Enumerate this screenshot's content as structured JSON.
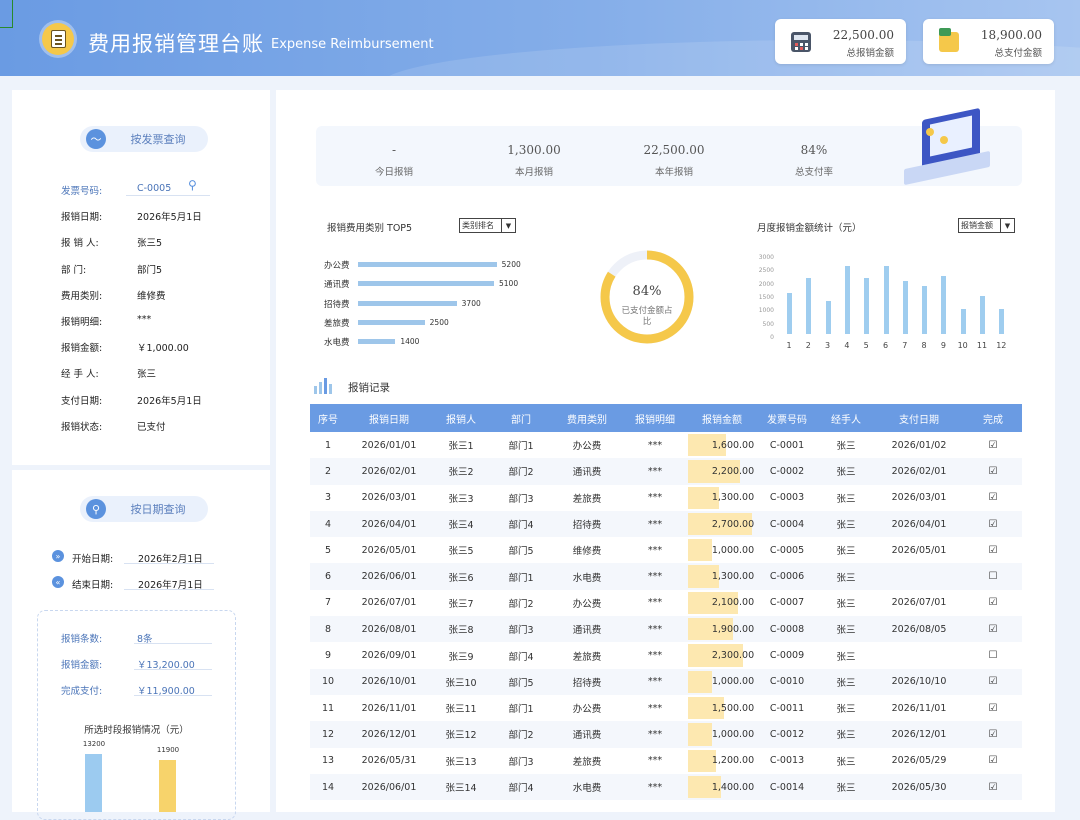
{
  "header": {
    "title": "费用报销管理台账",
    "subtitle": "Expense Reimbursement",
    "cards": [
      {
        "value": "22,500.00",
        "label": "总报销金额",
        "icon": "calculator-icon"
      },
      {
        "value": "18,900.00",
        "label": "总支付金额",
        "icon": "wallet-icon"
      }
    ]
  },
  "invoice_query": {
    "button": "按发票查询",
    "fields": [
      {
        "label": "发票号码:",
        "value": "C-0005"
      },
      {
        "label": "报销日期:",
        "value": "2026年5月1日"
      },
      {
        "label": "报 销 人:",
        "value": "张三5"
      },
      {
        "label": "部     门:",
        "value": "部门5"
      },
      {
        "label": "费用类别:",
        "value": "维修费"
      },
      {
        "label": "报销明细:",
        "value": "***"
      },
      {
        "label": "报销金额:",
        "value": "￥1,000.00"
      },
      {
        "label": "经 手 人:",
        "value": "张三"
      },
      {
        "label": "支付日期:",
        "value": "2026年5月1日"
      },
      {
        "label": "报销状态:",
        "value": "已支付"
      }
    ]
  },
  "date_query": {
    "button": "按日期查询",
    "start": {
      "label": "开始日期:",
      "value": "2026年2月1日"
    },
    "end": {
      "label": "结束日期:",
      "value": "2026年7月1日"
    },
    "summary": [
      {
        "label": "报销条数:",
        "value": "8条"
      },
      {
        "label": "报销金额:",
        "value": "￥13,200.00"
      },
      {
        "label": "完成支付:",
        "value": "￥11,900.00"
      }
    ],
    "chart": {
      "title": "所选时段报销情况（元）",
      "values": [
        {
          "value": 13200,
          "label": "13200",
          "color": "#9ccbf0"
        },
        {
          "value": 11900,
          "label": "11900",
          "color": "#f7d36b"
        }
      ]
    }
  },
  "stats": [
    {
      "value": "-",
      "label": "今日报销"
    },
    {
      "value": "1,300.00",
      "label": "本月报销"
    },
    {
      "value": "22,500.00",
      "label": "本年报销"
    },
    {
      "value": "84%",
      "label": "总支付率"
    }
  ],
  "top5": {
    "title": "报销费用类别 TOP5",
    "select": "类别排名",
    "chart_data": {
      "type": "bar",
      "categories": [
        "办公费",
        "通讯费",
        "招待费",
        "差旅费",
        "水电费"
      ],
      "values": [
        5200,
        5100,
        3700,
        2500,
        1400
      ],
      "xlim": [
        0,
        6000
      ]
    }
  },
  "donut": {
    "value": "84%",
    "label": "已支付金额占比",
    "fraction": 0.84
  },
  "monthly": {
    "title": "月度报销金额统计（元）",
    "select": "报销金额",
    "chart_data": {
      "type": "bar",
      "categories": [
        "1",
        "2",
        "3",
        "4",
        "5",
        "6",
        "7",
        "8",
        "9",
        "10",
        "11",
        "12"
      ],
      "values": [
        1600,
        2200,
        1300,
        2700,
        2200,
        2700,
        2100,
        1900,
        2300,
        1000,
        1500,
        1000
      ],
      "yticks": [
        "3000",
        "2500",
        "2000",
        "1500",
        "1000",
        "500",
        "0"
      ],
      "ylim": [
        0,
        3000
      ]
    }
  },
  "records": {
    "title": "报销记录",
    "columns": [
      "序号",
      "报销日期",
      "报销人",
      "部门",
      "费用类别",
      "报销明细",
      "报销金额",
      "发票号码",
      "经手人",
      "支付日期",
      "完成"
    ],
    "amount_max": 2700,
    "rows": [
      [
        "1",
        "2026/01/01",
        "张三1",
        "部门1",
        "办公费",
        "***",
        "1,600.00",
        "C-0001",
        "张三",
        "2026/01/02",
        "☑"
      ],
      [
        "2",
        "2026/02/01",
        "张三2",
        "部门2",
        "通讯费",
        "***",
        "2,200.00",
        "C-0002",
        "张三",
        "2026/02/01",
        "☑"
      ],
      [
        "3",
        "2026/03/01",
        "张三3",
        "部门3",
        "差旅费",
        "***",
        "1,300.00",
        "C-0003",
        "张三",
        "2026/03/01",
        "☑"
      ],
      [
        "4",
        "2026/04/01",
        "张三4",
        "部门4",
        "招待费",
        "***",
        "2,700.00",
        "C-0004",
        "张三",
        "2026/04/01",
        "☑"
      ],
      [
        "5",
        "2026/05/01",
        "张三5",
        "部门5",
        "维修费",
        "***",
        "1,000.00",
        "C-0005",
        "张三",
        "2026/05/01",
        "☑"
      ],
      [
        "6",
        "2026/06/01",
        "张三6",
        "部门1",
        "水电费",
        "***",
        "1,300.00",
        "C-0006",
        "张三",
        "",
        "☐"
      ],
      [
        "7",
        "2026/07/01",
        "张三7",
        "部门2",
        "办公费",
        "***",
        "2,100.00",
        "C-0007",
        "张三",
        "2026/07/01",
        "☑"
      ],
      [
        "8",
        "2026/08/01",
        "张三8",
        "部门3",
        "通讯费",
        "***",
        "1,900.00",
        "C-0008",
        "张三",
        "2026/08/05",
        "☑"
      ],
      [
        "9",
        "2026/09/01",
        "张三9",
        "部门4",
        "差旅费",
        "***",
        "2,300.00",
        "C-0009",
        "张三",
        "",
        "☐"
      ],
      [
        "10",
        "2026/10/01",
        "张三10",
        "部门5",
        "招待费",
        "***",
        "1,000.00",
        "C-0010",
        "张三",
        "2026/10/10",
        "☑"
      ],
      [
        "11",
        "2026/11/01",
        "张三11",
        "部门1",
        "办公费",
        "***",
        "1,500.00",
        "C-0011",
        "张三",
        "2026/11/01",
        "☑"
      ],
      [
        "12",
        "2026/12/01",
        "张三12",
        "部门2",
        "通讯费",
        "***",
        "1,000.00",
        "C-0012",
        "张三",
        "2026/12/01",
        "☑"
      ],
      [
        "13",
        "2026/05/31",
        "张三13",
        "部门3",
        "差旅费",
        "***",
        "1,200.00",
        "C-0013",
        "张三",
        "2026/05/29",
        "☑"
      ],
      [
        "14",
        "2026/06/01",
        "张三14",
        "部门4",
        "水电费",
        "***",
        "1,400.00",
        "C-0014",
        "张三",
        "2026/05/30",
        "☑"
      ]
    ]
  }
}
